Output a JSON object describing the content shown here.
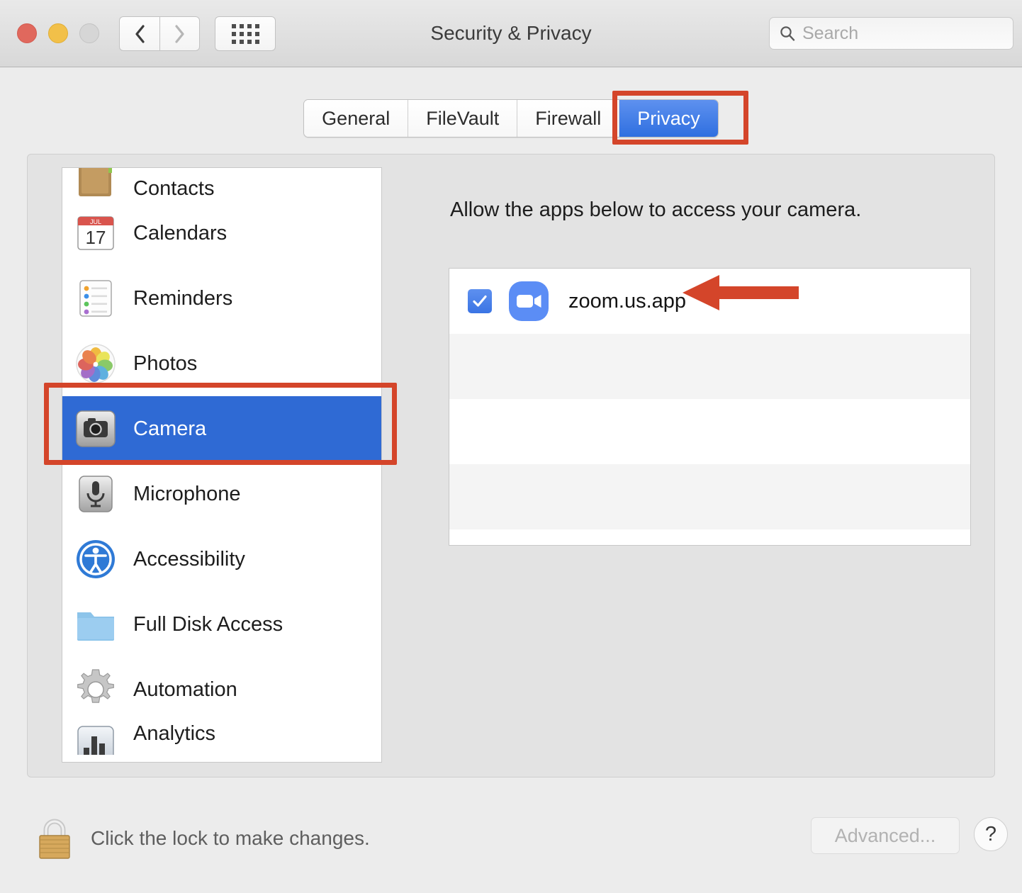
{
  "window": {
    "title": "Security & Privacy",
    "traffic_lights": [
      "close-red",
      "minimize-yellow",
      "zoom-gray-disabled"
    ],
    "nav": {
      "back": "back-chevron",
      "forward": "forward-chevron",
      "grid": "show-all-grid"
    }
  },
  "search": {
    "placeholder": "Search",
    "value": "",
    "icon": "search-icon"
  },
  "tabs": [
    {
      "label": "General",
      "active": false
    },
    {
      "label": "FileVault",
      "active": false
    },
    {
      "label": "Firewall",
      "active": false
    },
    {
      "label": "Privacy",
      "active": true
    }
  ],
  "sidebar": {
    "items": [
      {
        "label": "Contacts",
        "icon": "contacts-icon",
        "selected": false,
        "clipped": "top"
      },
      {
        "label": "Calendars",
        "icon": "calendar-icon",
        "selected": false
      },
      {
        "label": "Reminders",
        "icon": "reminders-icon",
        "selected": false
      },
      {
        "label": "Photos",
        "icon": "photos-icon",
        "selected": false
      },
      {
        "label": "Camera",
        "icon": "camera-icon",
        "selected": true
      },
      {
        "label": "Microphone",
        "icon": "microphone-icon",
        "selected": false
      },
      {
        "label": "Accessibility",
        "icon": "accessibility-icon",
        "selected": false
      },
      {
        "label": "Full Disk Access",
        "icon": "folder-icon",
        "selected": false
      },
      {
        "label": "Automation",
        "icon": "gear-icon",
        "selected": false
      },
      {
        "label": "Analytics",
        "icon": "analytics-icon",
        "selected": false,
        "clipped": "bottom"
      }
    ]
  },
  "main": {
    "description": "Allow the apps below to access your camera.",
    "apps": [
      {
        "name": "zoom.us.app",
        "checked": true,
        "icon": "zoom-video-icon"
      },
      {
        "name": "",
        "checked": false,
        "icon": ""
      },
      {
        "name": "",
        "checked": false,
        "icon": ""
      },
      {
        "name": "",
        "checked": false,
        "icon": ""
      },
      {
        "name": "",
        "checked": false,
        "icon": ""
      }
    ]
  },
  "bottom": {
    "lock_icon": "padlock-closed-icon",
    "lock_text": "Click the lock to make changes.",
    "advanced_label": "Advanced...",
    "help_label": "?"
  },
  "annotations": {
    "color": "#d4452a",
    "privacy_tab_box": "highlight-rectangle",
    "camera_row_box": "highlight-rectangle",
    "zoom_app_arrow": "left-pointing-arrow"
  },
  "colors": {
    "selection_blue": "#2f6ad4",
    "tab_blue": "#2f6fe0",
    "annotation_red": "#d4452a",
    "zoom_icon_blue": "#5b8df5"
  }
}
